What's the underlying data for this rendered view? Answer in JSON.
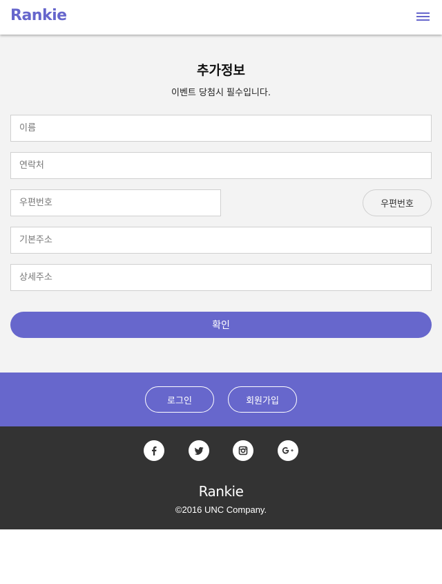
{
  "header": {
    "logo": "Rankie",
    "menu_icon": "hamburger-menu-icon",
    "accent_color": "#6666cc"
  },
  "form": {
    "title": "추가정보",
    "subtitle": "이벤트 당첨시 필수입니다.",
    "fields": {
      "name": {
        "placeholder": "이름",
        "value": ""
      },
      "phone": {
        "placeholder": "연락처",
        "value": ""
      },
      "zipcode": {
        "placeholder": "우편번호",
        "value": ""
      },
      "address": {
        "placeholder": "기본주소",
        "value": ""
      },
      "address_detail": {
        "placeholder": "상세주소",
        "value": ""
      }
    },
    "zipcode_button": "우편번호",
    "confirm_button": "확인"
  },
  "auth": {
    "login": "로그인",
    "signup": "회원가입"
  },
  "footer": {
    "social_icons": [
      "facebook-icon",
      "twitter-icon",
      "instagram-icon",
      "google-plus-icon"
    ],
    "logo": "Rankie",
    "copyright": "©2016 UNC Company."
  }
}
